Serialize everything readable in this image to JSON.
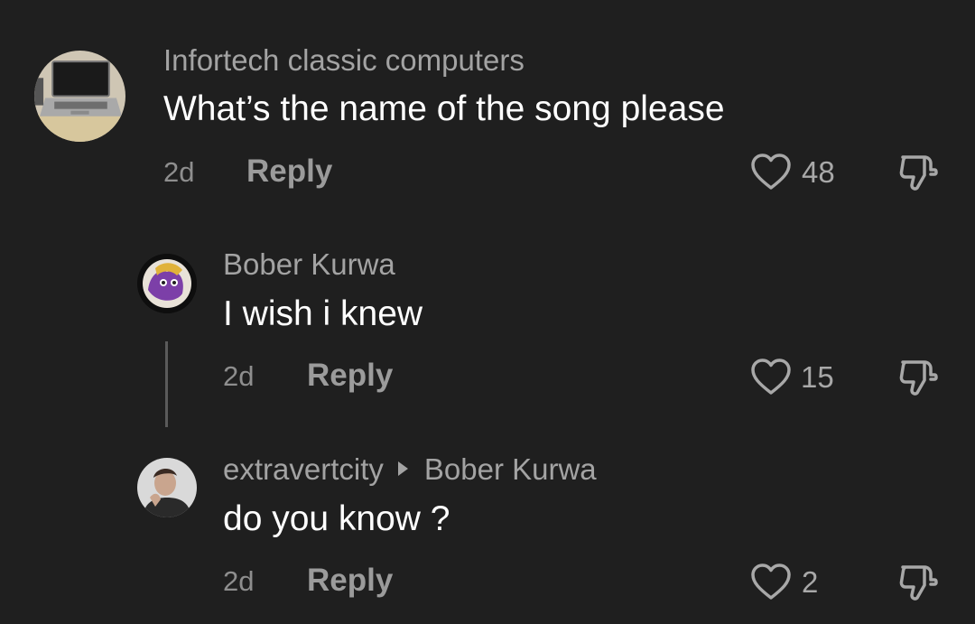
{
  "colors": {
    "background": "#1f1f1f",
    "username": "#a3a3a3",
    "text": "#ffffff",
    "meta": "#8e8e8e"
  },
  "comments": [
    {
      "username": "Infortech classic computers",
      "text": "What’s the name of the song please",
      "time": "2d",
      "reply_label": "Reply",
      "likes": "48",
      "avatar_icon": "laptop-avatar"
    },
    {
      "username": "Bober Kurwa",
      "text": "I wish i knew",
      "time": "2d",
      "reply_label": "Reply",
      "likes": "15",
      "avatar_icon": "cartoon-avatar"
    },
    {
      "username": "extravertcity",
      "reply_to": "Bober Kurwa",
      "text": "do you know ?",
      "time": "2d",
      "reply_label": "Reply",
      "likes": "2",
      "avatar_icon": "person-avatar"
    }
  ]
}
